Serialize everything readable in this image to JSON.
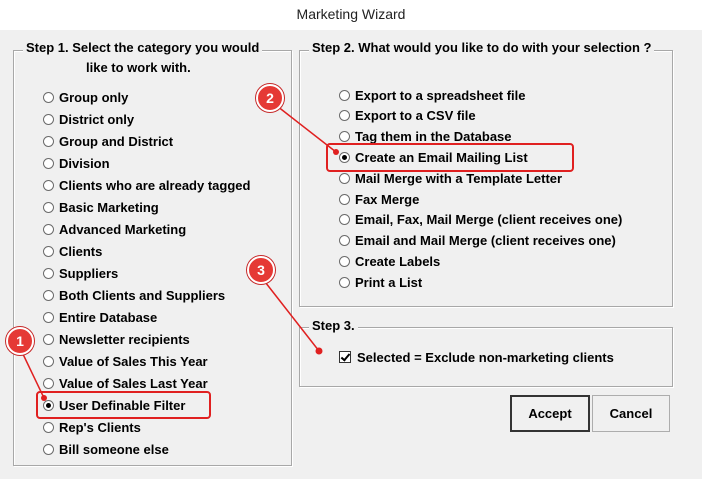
{
  "window": {
    "title": "Marketing Wizard"
  },
  "step1": {
    "legend_line1": "Step 1.  Select the category you would",
    "legend_line2": "like to work with.",
    "options": [
      "Group only",
      "District only",
      "Group and District",
      "Division",
      "Clients who are already tagged",
      "Basic Marketing",
      "Advanced Marketing",
      "Clients",
      "Suppliers",
      "Both Clients and Suppliers",
      "Entire Database",
      "Newsletter recipients",
      "Value of Sales This Year",
      "Value of Sales Last Year",
      "User Definable Filter",
      "Rep's Clients",
      "Bill someone else"
    ],
    "selected": "User Definable Filter"
  },
  "step2": {
    "legend": "Step 2. What would you like to do with your selection ?",
    "options": [
      "Export to a spreadsheet file",
      "Export to a CSV file",
      "Tag them in the Database",
      "Create an Email Mailing List",
      "Mail Merge with a Template Letter",
      "Fax Merge",
      "Email, Fax, Mail Merge (client receives one)",
      "Email and Mail Merge (client receives one)",
      "Create Labels",
      "Print a List"
    ],
    "selected": "Create an Email Mailing List"
  },
  "step3": {
    "legend": "Step 3.",
    "checkbox_label": "Selected = Exclude non-marketing clients",
    "checked": true
  },
  "buttons": {
    "accept": "Accept",
    "cancel": "Cancel"
  },
  "annotations": {
    "badge1": "1",
    "badge2": "2",
    "badge3": "3",
    "color": "#e53935"
  }
}
